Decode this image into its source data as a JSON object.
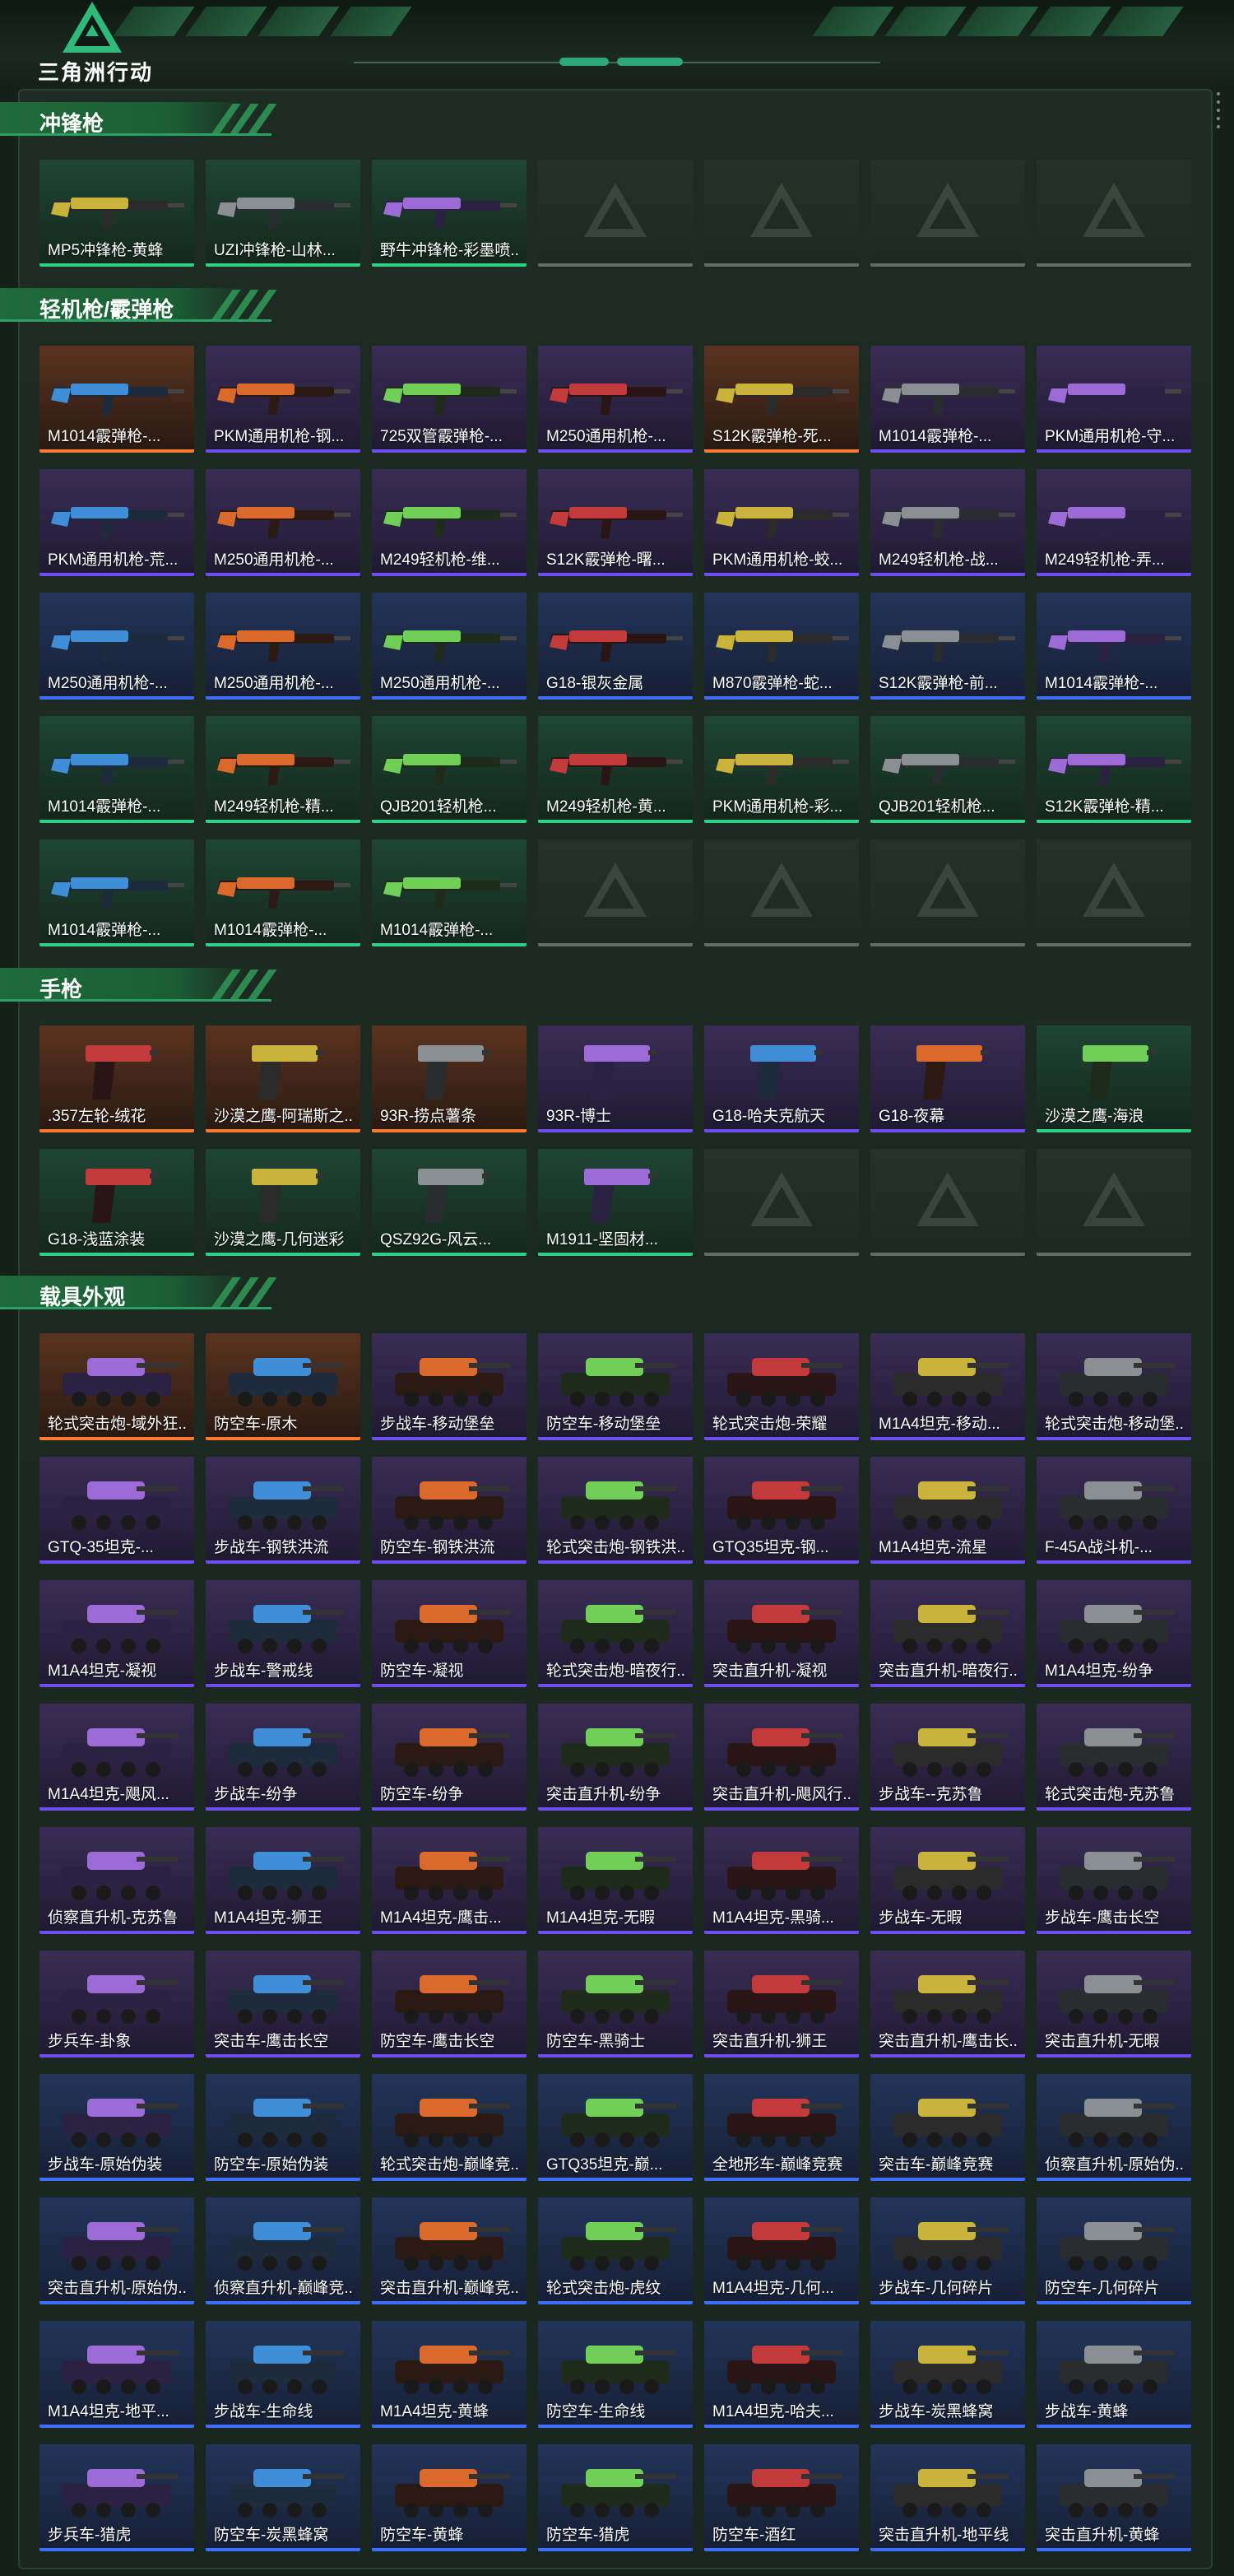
{
  "app": {
    "name": "三角洲行动"
  },
  "colors": {
    "accent": "#2aa162",
    "rarity_purple": "#6f4df0",
    "rarity_blue": "#3e6dff",
    "rarity_green": "#2fcf86",
    "rarity_orange": "#ff7a2e"
  },
  "sections": [
    {
      "title": "冲锋枪",
      "kind": "gun",
      "items": [
        {
          "label": "MP5冲锋枪-黄蜂",
          "rarity": "green"
        },
        {
          "label": "UZI冲锋枪-山林...",
          "rarity": "green"
        },
        {
          "label": "野牛冲锋枪-彩墨喷...",
          "rarity": "green"
        },
        {
          "label": "",
          "rarity": "empty"
        },
        {
          "label": "",
          "rarity": "empty"
        },
        {
          "label": "",
          "rarity": "empty"
        },
        {
          "label": "",
          "rarity": "empty"
        }
      ]
    },
    {
      "title": "轻机枪/霰弹枪",
      "kind": "gun",
      "items": [
        {
          "label": "M1014霰弹枪-...",
          "rarity": "orange"
        },
        {
          "label": "PKM通用机枪-钢...",
          "rarity": "purple"
        },
        {
          "label": "725双管霰弹枪-...",
          "rarity": "purple"
        },
        {
          "label": "M250通用机枪-...",
          "rarity": "purple"
        },
        {
          "label": "S12K霰弹枪-死...",
          "rarity": "orange"
        },
        {
          "label": "M1014霰弹枪-...",
          "rarity": "purple"
        },
        {
          "label": "PKM通用机枪-守...",
          "rarity": "purple"
        },
        {
          "label": "PKM通用机枪-荒...",
          "rarity": "purple"
        },
        {
          "label": "M250通用机枪-...",
          "rarity": "purple"
        },
        {
          "label": "M249轻机枪-维...",
          "rarity": "purple"
        },
        {
          "label": "S12K霰弹枪-曙...",
          "rarity": "purple"
        },
        {
          "label": "PKM通用机枪-蛟...",
          "rarity": "purple"
        },
        {
          "label": "M249轻机枪-战...",
          "rarity": "purple"
        },
        {
          "label": "M249轻机枪-弄...",
          "rarity": "purple"
        },
        {
          "label": "M250通用机枪-...",
          "rarity": "blue"
        },
        {
          "label": "M250通用机枪-...",
          "rarity": "blue"
        },
        {
          "label": "M250通用机枪-...",
          "rarity": "blue"
        },
        {
          "label": "G18-银灰金属",
          "rarity": "blue"
        },
        {
          "label": "M870霰弹枪-蛇...",
          "rarity": "blue"
        },
        {
          "label": "S12K霰弹枪-前...",
          "rarity": "blue"
        },
        {
          "label": "M1014霰弹枪-...",
          "rarity": "blue"
        },
        {
          "label": "M1014霰弹枪-...",
          "rarity": "green"
        },
        {
          "label": "M249轻机枪-精...",
          "rarity": "green"
        },
        {
          "label": "QJB201轻机枪...",
          "rarity": "green"
        },
        {
          "label": "M249轻机枪-黄...",
          "rarity": "green"
        },
        {
          "label": "PKM通用机枪-彩...",
          "rarity": "green"
        },
        {
          "label": "QJB201轻机枪...",
          "rarity": "green"
        },
        {
          "label": "S12K霰弹枪-精...",
          "rarity": "green"
        },
        {
          "label": "M1014霰弹枪-...",
          "rarity": "green"
        },
        {
          "label": "M1014霰弹枪-...",
          "rarity": "green"
        },
        {
          "label": "M1014霰弹枪-...",
          "rarity": "green"
        },
        {
          "label": "",
          "rarity": "empty"
        },
        {
          "label": "",
          "rarity": "empty"
        },
        {
          "label": "",
          "rarity": "empty"
        },
        {
          "label": "",
          "rarity": "empty"
        }
      ]
    },
    {
      "title": "手枪",
      "kind": "pistol",
      "items": [
        {
          "label": ".357左轮-绒花",
          "rarity": "orange"
        },
        {
          "label": "沙漠之鹰-阿瑞斯之...",
          "rarity": "orange"
        },
        {
          "label": "93R-捞点薯条",
          "rarity": "orange"
        },
        {
          "label": "93R-博士",
          "rarity": "purple"
        },
        {
          "label": "G18-哈夫克航天",
          "rarity": "purple"
        },
        {
          "label": "G18-夜幕",
          "rarity": "purple"
        },
        {
          "label": "沙漠之鹰-海浪",
          "rarity": "green"
        },
        {
          "label": "G18-浅蓝涂装",
          "rarity": "green"
        },
        {
          "label": "沙漠之鹰-几何迷彩",
          "rarity": "green"
        },
        {
          "label": "QSZ92G-风云...",
          "rarity": "green"
        },
        {
          "label": "M1911-坚固材...",
          "rarity": "green"
        },
        {
          "label": "",
          "rarity": "empty"
        },
        {
          "label": "",
          "rarity": "empty"
        },
        {
          "label": "",
          "rarity": "empty"
        }
      ]
    },
    {
      "title": "载具外观",
      "kind": "vehicle",
      "items": [
        {
          "label": "轮式突击炮-域外狂...",
          "rarity": "orange"
        },
        {
          "label": "防空车-原木",
          "rarity": "orange"
        },
        {
          "label": "步战车-移动堡垒",
          "rarity": "purple"
        },
        {
          "label": "防空车-移动堡垒",
          "rarity": "purple"
        },
        {
          "label": "轮式突击炮-荣耀",
          "rarity": "purple"
        },
        {
          "label": "M1A4坦克-移动...",
          "rarity": "purple"
        },
        {
          "label": "轮式突击炮-移动堡...",
          "rarity": "purple"
        },
        {
          "label": "GTQ-35坦克-...",
          "rarity": "purple"
        },
        {
          "label": "步战车-钢铁洪流",
          "rarity": "purple"
        },
        {
          "label": "防空车-钢铁洪流",
          "rarity": "purple"
        },
        {
          "label": "轮式突击炮-钢铁洪...",
          "rarity": "purple"
        },
        {
          "label": "GTQ35坦克-钢...",
          "rarity": "purple"
        },
        {
          "label": "M1A4坦克-流星",
          "rarity": "purple"
        },
        {
          "label": "F-45A战斗机-...",
          "rarity": "purple"
        },
        {
          "label": "M1A4坦克-凝视",
          "rarity": "purple"
        },
        {
          "label": "步战车-警戒线",
          "rarity": "purple"
        },
        {
          "label": "防空车-凝视",
          "rarity": "purple"
        },
        {
          "label": "轮式突击炮-暗夜行...",
          "rarity": "purple"
        },
        {
          "label": "突击直升机-凝视",
          "rarity": "purple"
        },
        {
          "label": "突击直升机-暗夜行...",
          "rarity": "purple"
        },
        {
          "label": "M1A4坦克-纷争",
          "rarity": "purple"
        },
        {
          "label": "M1A4坦克-飓风...",
          "rarity": "purple"
        },
        {
          "label": "步战车-纷争",
          "rarity": "purple"
        },
        {
          "label": "防空车-纷争",
          "rarity": "purple"
        },
        {
          "label": "突击直升机-纷争",
          "rarity": "purple"
        },
        {
          "label": "突击直升机-飓风行...",
          "rarity": "purple"
        },
        {
          "label": "步战车--克苏鲁",
          "rarity": "purple"
        },
        {
          "label": "轮式突击炮-克苏鲁",
          "rarity": "purple"
        },
        {
          "label": "侦察直升机-克苏鲁",
          "rarity": "purple"
        },
        {
          "label": "M1A4坦克-狮王",
          "rarity": "purple"
        },
        {
          "label": "M1A4坦克-鹰击...",
          "rarity": "purple"
        },
        {
          "label": "M1A4坦克-无暇",
          "rarity": "purple"
        },
        {
          "label": "M1A4坦克-黑骑...",
          "rarity": "purple"
        },
        {
          "label": "步战车-无暇",
          "rarity": "purple"
        },
        {
          "label": "步战车-鹰击长空",
          "rarity": "purple"
        },
        {
          "label": "步兵车-卦象",
          "rarity": "purple"
        },
        {
          "label": "突击车-鹰击长空",
          "rarity": "purple"
        },
        {
          "label": "防空车-鹰击长空",
          "rarity": "purple"
        },
        {
          "label": "防空车-黑骑士",
          "rarity": "purple"
        },
        {
          "label": "突击直升机-狮王",
          "rarity": "purple"
        },
        {
          "label": "突击直升机-鹰击长...",
          "rarity": "purple"
        },
        {
          "label": "突击直升机-无暇",
          "rarity": "purple"
        },
        {
          "label": "步战车-原始伪装",
          "rarity": "blue"
        },
        {
          "label": "防空车-原始伪装",
          "rarity": "blue"
        },
        {
          "label": "轮式突击炮-巅峰竞...",
          "rarity": "blue"
        },
        {
          "label": "GTQ35坦克-巅...",
          "rarity": "blue"
        },
        {
          "label": "全地形车-巅峰竞赛",
          "rarity": "blue"
        },
        {
          "label": "突击车-巅峰竞赛",
          "rarity": "blue"
        },
        {
          "label": "侦察直升机-原始伪...",
          "rarity": "blue"
        },
        {
          "label": "突击直升机-原始伪...",
          "rarity": "blue"
        },
        {
          "label": "侦察直升机-巅峰竞...",
          "rarity": "blue"
        },
        {
          "label": "突击直升机-巅峰竞...",
          "rarity": "blue"
        },
        {
          "label": "轮式突击炮-虎纹",
          "rarity": "blue"
        },
        {
          "label": "M1A4坦克-几何...",
          "rarity": "blue"
        },
        {
          "label": "步战车-几何碎片",
          "rarity": "blue"
        },
        {
          "label": "防空车-几何碎片",
          "rarity": "blue"
        },
        {
          "label": "M1A4坦克-地平...",
          "rarity": "blue"
        },
        {
          "label": "步战车-生命线",
          "rarity": "blue"
        },
        {
          "label": "M1A4坦克-黄蜂",
          "rarity": "blue"
        },
        {
          "label": "防空车-生命线",
          "rarity": "blue"
        },
        {
          "label": "M1A4坦克-哈夫...",
          "rarity": "blue"
        },
        {
          "label": "步战车-炭黑蜂窝",
          "rarity": "blue"
        },
        {
          "label": "步战车-黄蜂",
          "rarity": "blue"
        },
        {
          "label": "步兵车-猎虎",
          "rarity": "blue"
        },
        {
          "label": "防空车-炭黑蜂窝",
          "rarity": "blue"
        },
        {
          "label": "防空车-黄蜂",
          "rarity": "blue"
        },
        {
          "label": "防空车-猎虎",
          "rarity": "blue"
        },
        {
          "label": "防空车-酒红",
          "rarity": "blue"
        },
        {
          "label": "突击直升机-地平线",
          "rarity": "blue"
        },
        {
          "label": "突击直升机-黄蜂",
          "rarity": "blue"
        }
      ]
    }
  ]
}
